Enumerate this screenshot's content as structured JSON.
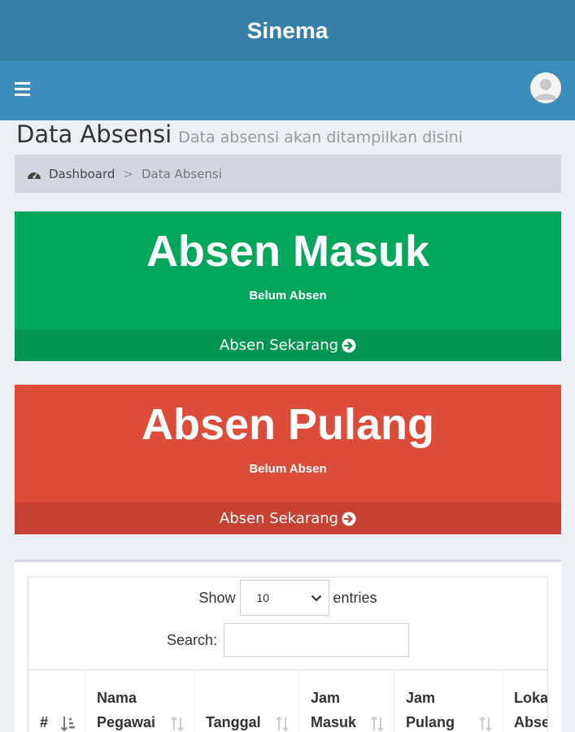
{
  "app": {
    "title": "Sinema"
  },
  "header": {
    "menu_icon": "bars-icon",
    "user_icon": "user-avatar-icon"
  },
  "page": {
    "title": "Data Absensi",
    "subtitle": "Data absensi akan ditampilkan disini"
  },
  "breadcrumb": {
    "icon": "dashboard-icon",
    "home": "Dashboard",
    "separator": ">",
    "current": "Data Absensi"
  },
  "boxes": {
    "masuk": {
      "title": "Absen Masuk",
      "status": "Belum Absen",
      "action": "Absen Sekarang",
      "color": "#00a65a"
    },
    "pulang": {
      "title": "Absen Pulang",
      "status": "Belum Absen",
      "action": "Absen Sekarang",
      "color": "#dd4b39"
    }
  },
  "table": {
    "length_prefix": "Show",
    "length_value": "10",
    "length_suffix": "entries",
    "search_label": "Search:",
    "columns": [
      "#",
      "Nama\nPegawai",
      "Tanggal",
      "Jam\nMasuk",
      "Jam\nPulang",
      "Lokasi\nAbsen"
    ]
  }
}
